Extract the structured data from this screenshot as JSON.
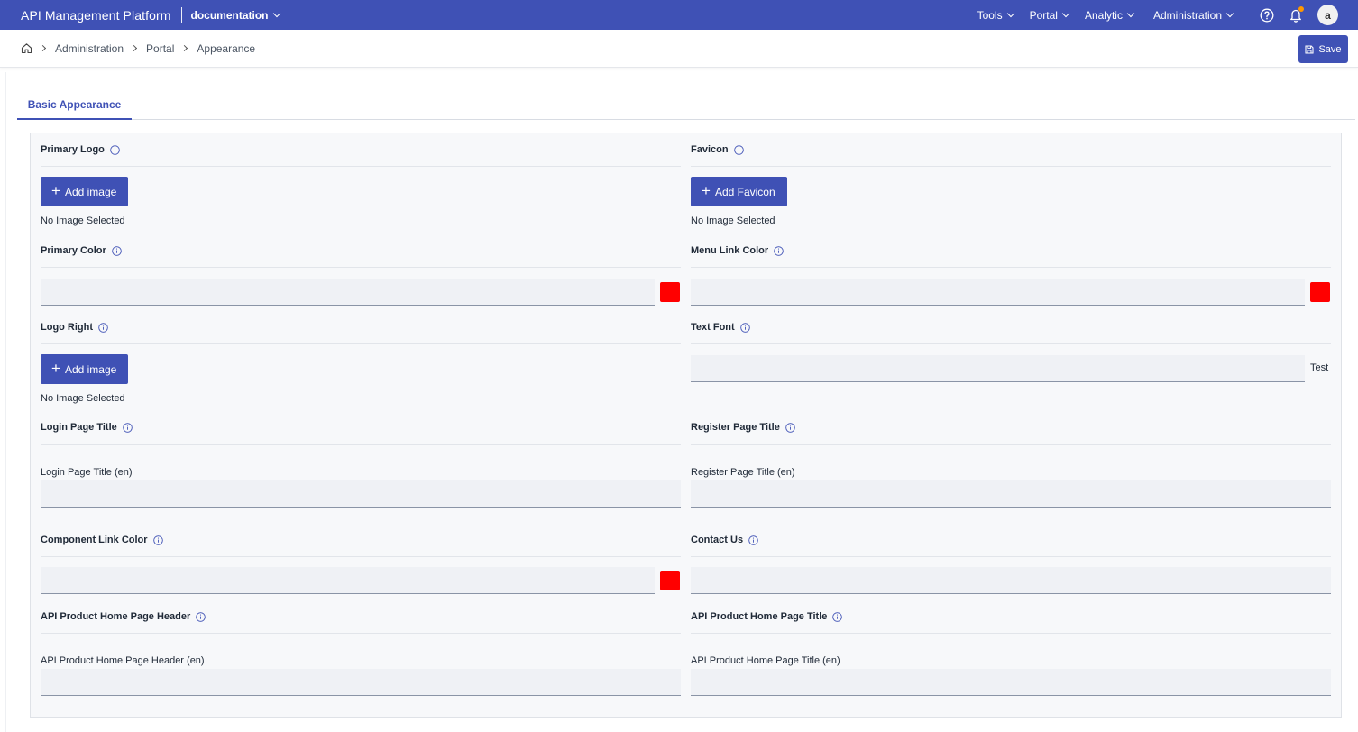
{
  "topbar": {
    "brand": "API Management Platform",
    "workspace": "documentation",
    "nav": [
      "Tools",
      "Portal",
      "Analytic",
      "Administration"
    ],
    "icons": [
      "help-circle-icon",
      "bell-icon"
    ],
    "avatar": "a",
    "color": "#3f51b5",
    "notification_dot_color": "#ff9800"
  },
  "breadcrumb": {
    "items": [
      "Administration",
      "Portal",
      "Appearance"
    ],
    "save_label": "Save"
  },
  "tabs": [
    "Basic Appearance"
  ],
  "form": {
    "primary_logo": {
      "label": "Primary Logo",
      "button": "Add image",
      "status": "No Image Selected"
    },
    "favicon": {
      "label": "Favicon",
      "button": "Add Favicon",
      "status": "No Image Selected"
    },
    "primary_color": {
      "label": "Primary Color",
      "value": "",
      "swatch": "#ff0000"
    },
    "menu_link_color": {
      "label": "Menu Link Color",
      "value": "",
      "swatch": "#ff0000"
    },
    "logo_right": {
      "label": "Logo Right",
      "button": "Add image",
      "status": "No Image Selected"
    },
    "text_font": {
      "label": "Text Font",
      "value": "",
      "preview": "Test"
    },
    "login_page_title": {
      "label": "Login Page Title",
      "sublabel": "Login Page Title (en)",
      "value": ""
    },
    "register_page_title": {
      "label": "Register Page Title",
      "sublabel": "Register Page Title (en)",
      "value": ""
    },
    "component_link_color": {
      "label": "Component Link Color",
      "value": "",
      "swatch": "#ff0000"
    },
    "contact_us": {
      "label": "Contact Us",
      "value": ""
    },
    "api_product_home_page_header": {
      "label": "API Product Home Page Header",
      "sublabel": "API Product Home Page Header (en)",
      "value": ""
    },
    "api_product_home_page_title": {
      "label": "API Product Home Page Title",
      "sublabel": "API Product Home Page Title (en)",
      "value": ""
    }
  }
}
